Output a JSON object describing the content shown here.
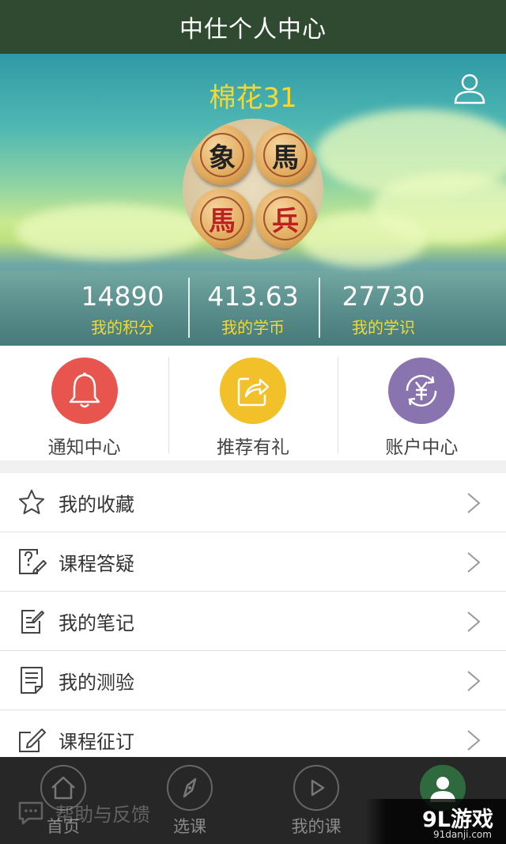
{
  "header": {
    "title": "中仕个人中心"
  },
  "profile": {
    "username": "棉花31",
    "avatar_pieces": [
      "象",
      "馬",
      "馬",
      "兵"
    ],
    "stats": [
      {
        "value": "14890",
        "label": "我的积分"
      },
      {
        "value": "413.63",
        "label": "我的学币"
      },
      {
        "value": "27730",
        "label": "我的学识"
      }
    ]
  },
  "quick_actions": [
    {
      "label": "通知中心",
      "icon": "bell-icon",
      "color": "#e8544e"
    },
    {
      "label": "推荐有礼",
      "icon": "share-icon",
      "color": "#f2c028"
    },
    {
      "label": "账户中心",
      "icon": "yuan-exchange-icon",
      "color": "#8a74b0"
    }
  ],
  "menu": [
    {
      "label": "我的收藏",
      "icon": "star-icon"
    },
    {
      "label": "课程答疑",
      "icon": "question-edit-icon"
    },
    {
      "label": "我的笔记",
      "icon": "note-icon"
    },
    {
      "label": "我的测验",
      "icon": "quiz-document-icon"
    },
    {
      "label": "课程征订",
      "icon": "edit-order-icon"
    }
  ],
  "help_item": {
    "label": "帮助与反馈",
    "icon": "chat-icon"
  },
  "bottom_nav": [
    {
      "label": "首页",
      "icon": "home-icon"
    },
    {
      "label": "选课",
      "icon": "compass-icon"
    },
    {
      "label": "我的课",
      "icon": "play-icon"
    },
    {
      "label": "",
      "icon": "person-icon",
      "active": true
    }
  ],
  "watermark": {
    "brand": "9L游戏",
    "url": "91danji.com"
  },
  "colors": {
    "header_bg": "#2f4a30",
    "accent_yellow": "#f5d832"
  }
}
